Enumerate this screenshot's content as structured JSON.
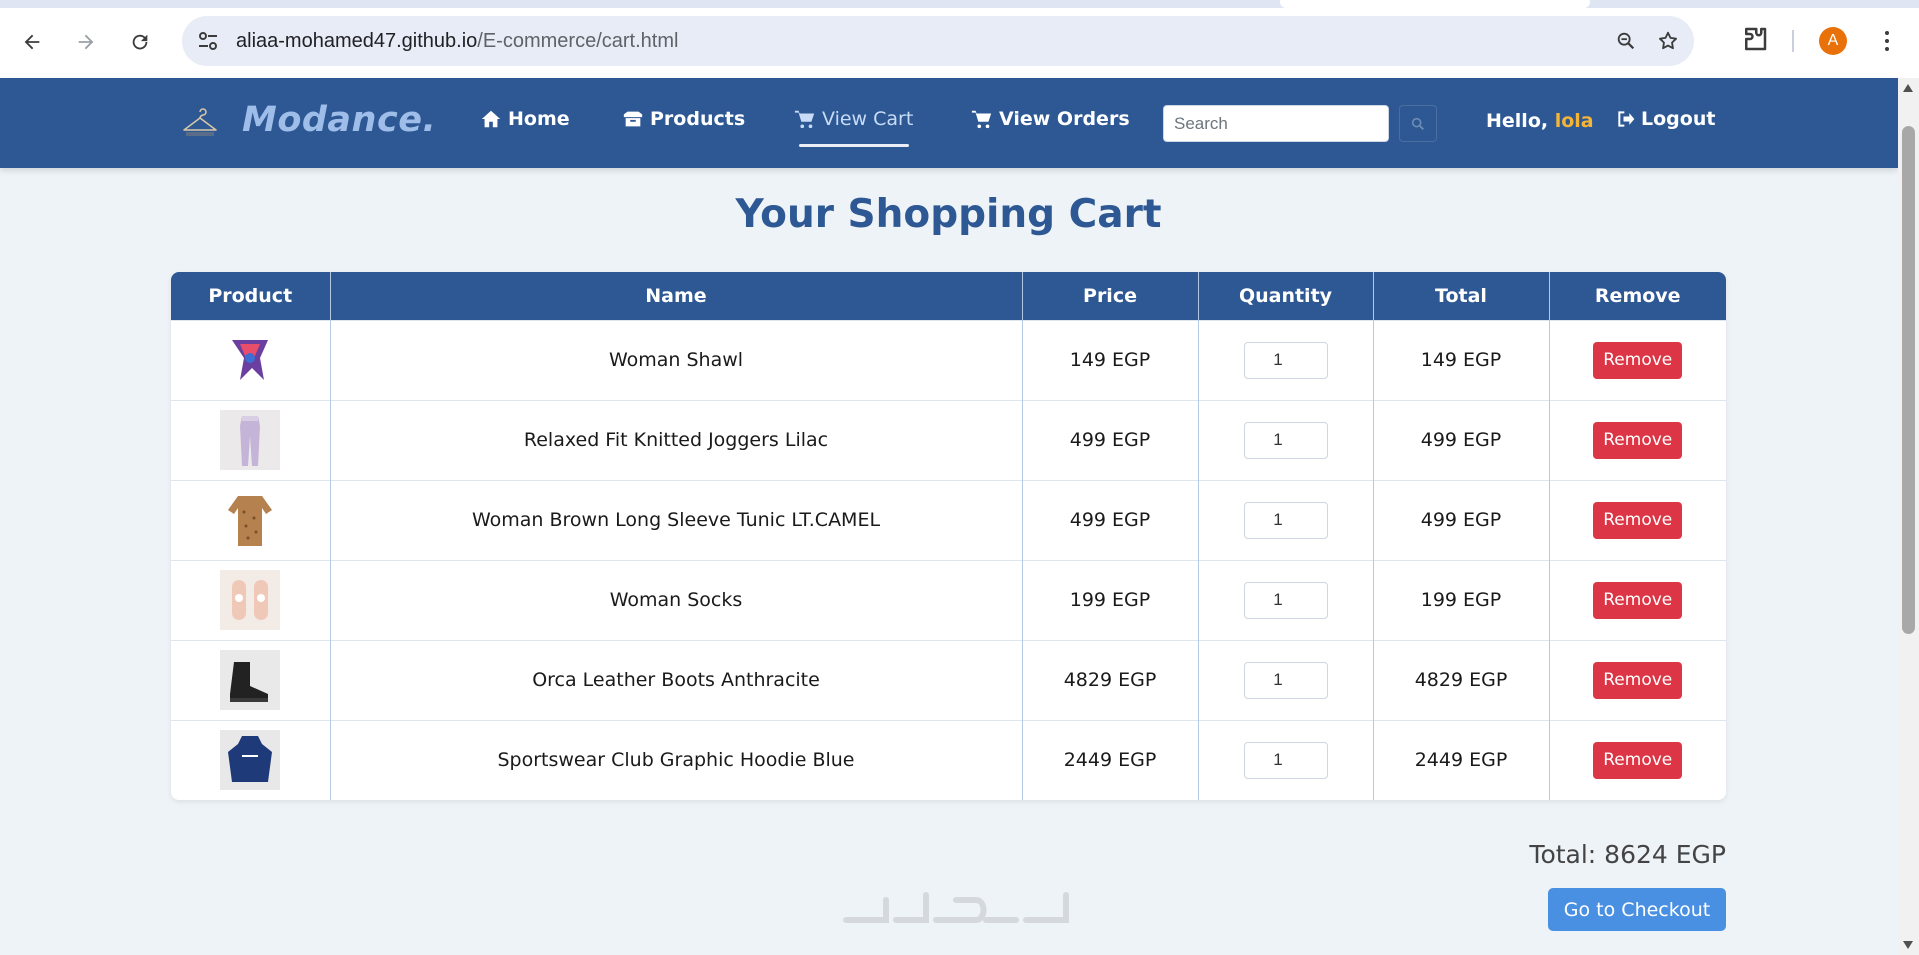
{
  "browser": {
    "url_host": "aliaa-mohamed47.github.io",
    "url_path": "/E-commerce/cart.html",
    "profile_initial": "A"
  },
  "header": {
    "brand": "Modance.",
    "nav": [
      {
        "label": "Home",
        "icon": "home-icon"
      },
      {
        "label": "Products",
        "icon": "box-icon"
      },
      {
        "label": "View Cart",
        "icon": "cart-icon",
        "active": true
      },
      {
        "label": "View Orders",
        "icon": "cart-icon"
      }
    ],
    "search_placeholder": "Search",
    "greeting": "Hello,",
    "username": "lola",
    "logout_label": "Logout"
  },
  "main": {
    "title": "Your Shopping Cart",
    "columns": [
      "Product",
      "Name",
      "Price",
      "Quantity",
      "Total",
      "Remove"
    ],
    "rows": [
      {
        "name": "Woman Shawl",
        "price": "149 EGP",
        "qty": "1",
        "total": "149 EGP",
        "remove": "Remove"
      },
      {
        "name": "Relaxed Fit Knitted Joggers Lilac",
        "price": "499 EGP",
        "qty": "1",
        "total": "499 EGP",
        "remove": "Remove"
      },
      {
        "name": "Woman Brown Long Sleeve Tunic LT.CAMEL",
        "price": "499 EGP",
        "qty": "1",
        "total": "499 EGP",
        "remove": "Remove"
      },
      {
        "name": "Woman Socks",
        "price": "199 EGP",
        "qty": "1",
        "total": "199 EGP",
        "remove": "Remove"
      },
      {
        "name": "Orca Leather Boots Anthracite",
        "price": "4829 EGP",
        "qty": "1",
        "total": "4829 EGP",
        "remove": "Remove"
      },
      {
        "name": "Sportswear Club Graphic Hoodie Blue",
        "price": "2449 EGP",
        "qty": "1",
        "total": "2449 EGP",
        "remove": "Remove"
      }
    ],
    "total_label": "Total: 8624 EGP",
    "checkout_label": "Go to Checkout"
  },
  "colors": {
    "primary": "#2d5894",
    "danger": "#dc3545",
    "accent_user": "#f6b437",
    "checkout": "#4a90e2"
  }
}
